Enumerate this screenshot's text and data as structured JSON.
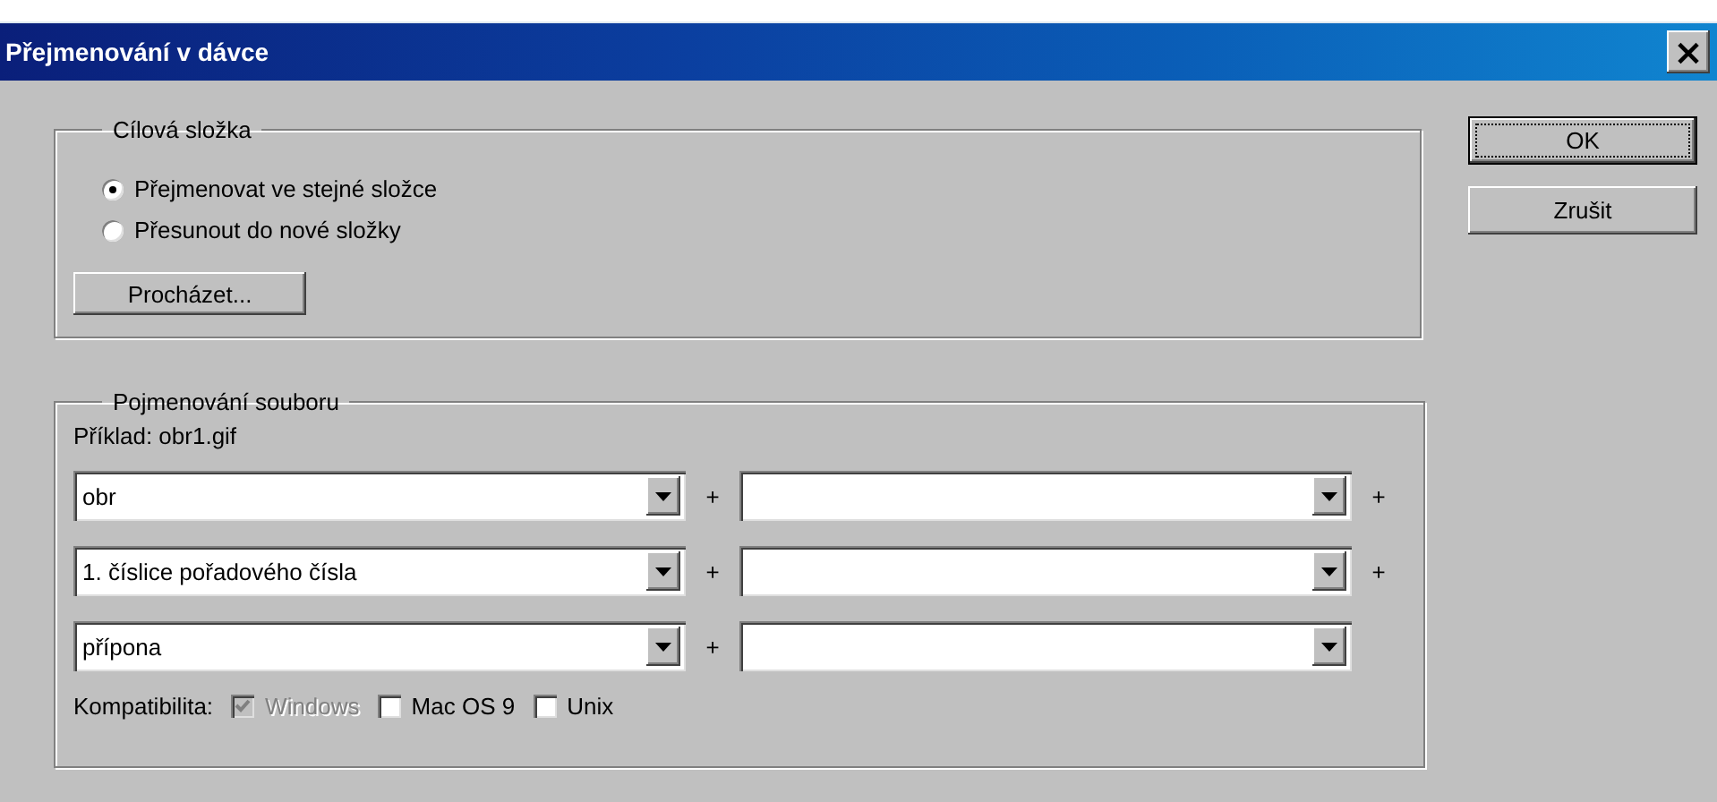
{
  "window": {
    "title": "Přejmenování v dávce",
    "close": "×"
  },
  "destination": {
    "title": "Cílová složka",
    "options": [
      {
        "label": "Přejmenovat ve stejné složce",
        "selected": true
      },
      {
        "label": "Přesunout do nové složky",
        "selected": false
      }
    ],
    "browse": "Procházet..."
  },
  "naming": {
    "title": "Pojmenování souboru",
    "example": "Příklad: obr1.gif",
    "rows": [
      {
        "fields": [
          {
            "kind": "combo",
            "value": "obr",
            "plus": "+"
          },
          {
            "kind": "combo",
            "plus": "+"
          }
        ]
      },
      {
        "fields": [
          {
            "kind": "combo",
            "value": "1. číslice pořadového čísla",
            "plus": "+"
          },
          {
            "kind": "combo",
            "plus": "+"
          }
        ]
      },
      {
        "fields": [
          {
            "kind": "combo",
            "value": "přípona",
            "plus": "+"
          },
          {
            "kind": "combo"
          }
        ]
      }
    ],
    "compat_label": "Kompatibilita:",
    "compat": [
      {
        "label": "Windows",
        "checked": true,
        "disabled": true
      },
      {
        "label": "Mac OS 9",
        "checked": false,
        "disabled": false
      },
      {
        "label": "Unix",
        "checked": false,
        "disabled": false
      }
    ]
  },
  "buttons": [
    {
      "label": "OK",
      "default": true
    },
    {
      "label": "Zrušit",
      "default": false
    }
  ]
}
